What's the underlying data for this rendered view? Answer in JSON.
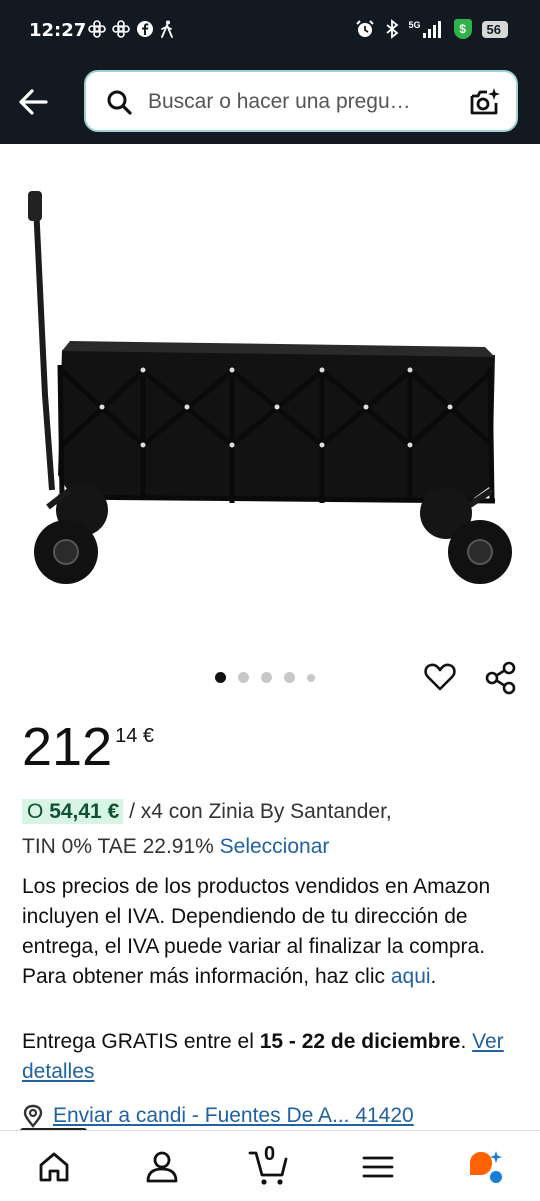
{
  "status_bar": {
    "time": "12:27",
    "network": "5G",
    "battery": "56",
    "left_icons": [
      "flower-icon",
      "flower-icon",
      "facebook-icon",
      "walking-icon"
    ],
    "right_icons": [
      "alarm-icon",
      "bluetooth-icon",
      "signal-icon",
      "shield-dollar-icon",
      "battery-icon"
    ]
  },
  "header": {
    "back_icon": "arrow-left-icon",
    "search_placeholder": "Buscar o hacer una pregu…",
    "camera_icon": "camera-sparkle-icon"
  },
  "product": {
    "image_description_icon": "collapsible-wagon-image",
    "image_count": 5,
    "active_image": 1,
    "price_whole": "212",
    "price_fraction": "14 €",
    "financing_prefix": "O",
    "financing_amount": "54,41 €",
    "financing_suffix": " / x4 con Zinia By Santander,",
    "financing_line2": "TIN 0% TAE 22.91% ",
    "financing_link": "Seleccionar",
    "vat_text": "Los precios de los productos vendidos en Amazon incluyen el IVA. Dependiendo de tu dirección de entrega, el IVA puede variar al finalizar la compra. Para obtener más información, haz clic ",
    "vat_link": "aqui",
    "vat_end": ".",
    "delivery_prefix": "Entrega GRATIS entre el ",
    "delivery_dates": "15 - 22 de diciembre",
    "delivery_dot": ". ",
    "delivery_link": "Ver detalles",
    "location_text": "Enviar a candi - Fuentes De A... 41420"
  },
  "colors": {
    "header_bg": "#131921",
    "link": "#2162a1",
    "financing_badge": "#d8f5e4",
    "search_border": "#9fd2d2"
  },
  "bottom_nav": {
    "items": [
      "home-icon",
      "account-icon",
      "cart-icon",
      "menu-icon",
      "rufus-ai-icon"
    ],
    "cart_count": "0"
  }
}
